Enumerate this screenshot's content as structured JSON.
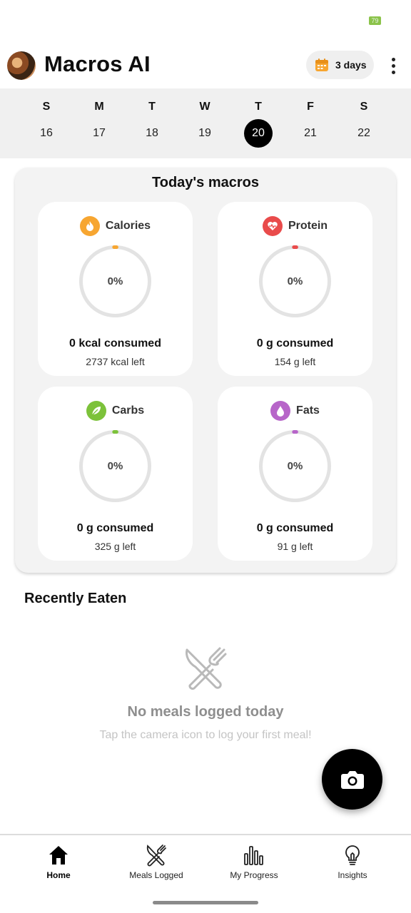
{
  "status_bar": {
    "battery_level": "79"
  },
  "header": {
    "title": "Macros AI",
    "logo_icon": "food-avatar-icon",
    "days_button_label": "3 days",
    "days_icon": "calendar-icon",
    "menu_icon": "more-vertical-icon"
  },
  "week": [
    {
      "letter": "S",
      "num": "16",
      "selected": false
    },
    {
      "letter": "M",
      "num": "17",
      "selected": false
    },
    {
      "letter": "T",
      "num": "18",
      "selected": false
    },
    {
      "letter": "W",
      "num": "19",
      "selected": false
    },
    {
      "letter": "T",
      "num": "20",
      "selected": true
    },
    {
      "letter": "F",
      "num": "21",
      "selected": false
    },
    {
      "letter": "S",
      "num": "22",
      "selected": false
    }
  ],
  "macros": {
    "title": "Today's macros",
    "items": [
      {
        "name": "Calories",
        "icon": "flame-icon",
        "color": "#f7a631",
        "percent": "0%",
        "progress": 0,
        "consumed": "0 kcal consumed",
        "left": "2737 kcal left"
      },
      {
        "name": "Protein",
        "icon": "heart-pulse-icon",
        "color": "#e94b4b",
        "percent": "0%",
        "progress": 0,
        "consumed": "0 g consumed",
        "left": "154 g left"
      },
      {
        "name": "Carbs",
        "icon": "leaf-icon",
        "color": "#7cc23a",
        "percent": "0%",
        "progress": 0,
        "consumed": "0 g consumed",
        "left": "325 g left"
      },
      {
        "name": "Fats",
        "icon": "droplet-icon",
        "color": "#b765c9",
        "percent": "0%",
        "progress": 0,
        "consumed": "0 g consumed",
        "left": "91 g left"
      }
    ]
  },
  "recent": {
    "title": "Recently Eaten",
    "empty_icon": "fork-knife-icon",
    "empty_title": "No meals logged today",
    "empty_subtitle": "Tap the camera icon to log your first meal!"
  },
  "fab": {
    "icon": "camera-icon"
  },
  "nav": {
    "items": [
      {
        "label": "Home",
        "icon": "home-icon",
        "active": true
      },
      {
        "label": "Meals Logged",
        "icon": "fork-knife-icon",
        "active": false
      },
      {
        "label": "My Progress",
        "icon": "bar-chart-icon",
        "active": false
      },
      {
        "label": "Insights",
        "icon": "lightbulb-icon",
        "active": false
      }
    ]
  }
}
